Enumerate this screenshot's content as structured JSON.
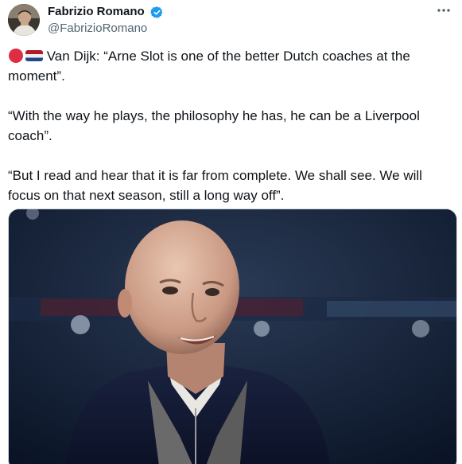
{
  "author": {
    "display_name": "Fabrizio Romano",
    "handle": "@FabrizioRomano",
    "verified": true,
    "avatar_icon": "avatar-photo"
  },
  "tweet": {
    "emojis": [
      "red-circle-icon",
      "netherlands-flag-icon"
    ],
    "paragraph_1": "Van Dijk: “Arne Slot is one of the better Dutch coaches at the moment”.",
    "paragraph_2": "“With the way he plays, the philosophy he has, he can be a Liverpool coach”.",
    "paragraph_3": "“But I read and hear that it is far from complete. We shall see. We will focus on that next season, still a long way off”."
  },
  "media": {
    "type": "photo"
  },
  "colors": {
    "text": "#0f1419",
    "secondary": "#536471",
    "verified": "#1d9bf0",
    "red_circle": "#dd2e44",
    "flag_red": "#ae1c28",
    "flag_blue": "#21468b"
  }
}
